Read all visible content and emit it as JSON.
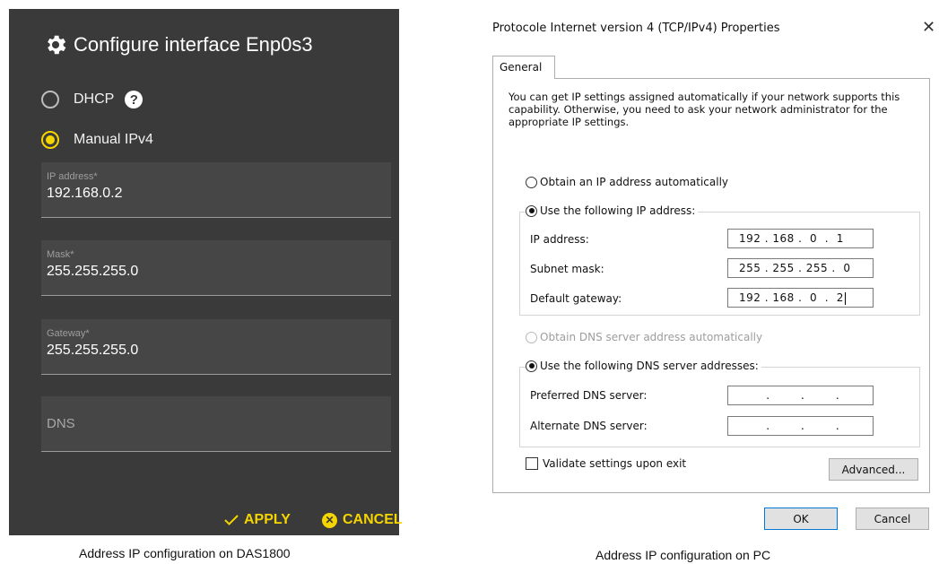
{
  "das": {
    "title": "Configure interface Enp0s3",
    "title_icon": "gear-icon",
    "dhcp_label": "DHCP",
    "help_glyph": "?",
    "manual_label": "Manual IPv4",
    "selected_mode": "Manual IPv4",
    "fields": [
      {
        "label": "IP address*",
        "value": "192.168.0.2"
      },
      {
        "label": "Mask*",
        "value": "255.255.255.0"
      },
      {
        "label": "Gateway*",
        "value": "255.255.255.0"
      }
    ],
    "dns_placeholder": "DNS",
    "apply_label": "APPLY",
    "cancel_label": "CANCEL",
    "accent_color": "#f5d400"
  },
  "captions": {
    "left": "Address IP configuration on DAS1800",
    "right": "Address IP configuration on PC"
  },
  "win": {
    "title": "Protocole Internet version 4 (TCP/IPv4) Properties",
    "close_glyph": "✕",
    "tab": "General",
    "description": "You can get IP settings assigned automatically if your network supports this capability. Otherwise, you need to ask your network administrator for the appropriate IP settings.",
    "obtain_ip_label": "Obtain an IP address automatically",
    "use_ip_label": "Use the following IP address:",
    "ip_rows": [
      {
        "label": "IP address:",
        "value": "192 . 168 .  0  .  1"
      },
      {
        "label": "Subnet mask:",
        "value": "255 . 255 . 255 .  0"
      },
      {
        "label": "Default gateway:",
        "value": "192 . 168 .  0  .  2"
      }
    ],
    "obtain_dns_label": "Obtain DNS server address automatically",
    "use_dns_label": "Use the following DNS server addresses:",
    "dns_rows": [
      {
        "label": "Preferred DNS server:",
        "value": "       .        .        ."
      },
      {
        "label": "Alternate DNS server:",
        "value": "       .        .        ."
      }
    ],
    "validate_label": "Validate settings upon exit",
    "advanced_label": "Advanced...",
    "ok_label": "OK",
    "cancel_label": "Cancel"
  }
}
